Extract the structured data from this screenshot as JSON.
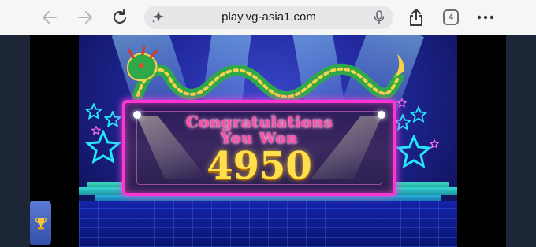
{
  "browser": {
    "url": "play.vg-asia1.com",
    "tab_count": "4"
  },
  "game": {
    "congrats_line1": "Congratulations",
    "congrats_line2": "You Won",
    "amount": "4950"
  },
  "colors": {
    "panel_border": "#ff35d3",
    "title_text": "#ff4fa8",
    "amount_text": "#ffe04a",
    "stars": "#25e6ff"
  }
}
